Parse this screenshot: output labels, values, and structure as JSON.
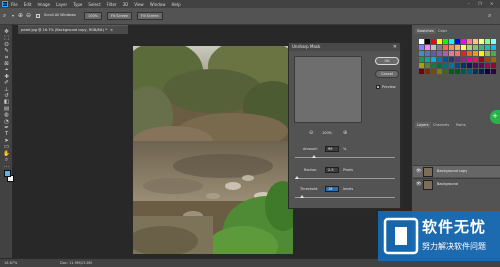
{
  "menubar": {
    "logo": "Ps",
    "items": [
      "File",
      "Edit",
      "Image",
      "Layer",
      "Type",
      "Select",
      "Filter",
      "3D",
      "View",
      "Window",
      "Help"
    ],
    "controls": {
      "minimize": "–",
      "maximize": "❐",
      "close": "✕"
    }
  },
  "optbar": {
    "scroll_all_label": "Scroll All Windows",
    "zoom_label": "100%",
    "fit_screen_label": "Fit Screen",
    "fill_screen_label": "Fill Screen"
  },
  "document": {
    "tab_title": "pexel.jpg @ 16.7% (Background copy, RGB/8#) *",
    "tab_close": "×"
  },
  "status": {
    "zoom": "16.67%",
    "doc_info": "Doc: 11.9M/23.8M"
  },
  "dialog": {
    "title": "Unsharp Mask",
    "close": "✕",
    "ok_label": "OK",
    "cancel_label": "Cancel",
    "preview_label": "Preview",
    "preview_checked": true,
    "zoom_out": "⊖",
    "zoom_in": "⊕",
    "zoom_pct": "100%",
    "amount": {
      "label": "Amount:",
      "value": "99",
      "unit": "%",
      "level": 0.19
    },
    "radius": {
      "label": "Radius:",
      "value": "2.5",
      "unit": "Pixels",
      "level": 0.02
    },
    "threshold": {
      "label": "Threshold:",
      "value": "18",
      "unit": "levels",
      "level": 0.07
    }
  },
  "panels": {
    "swatches_tabs": [
      "Swatches",
      "Color"
    ],
    "swatch_colors": [
      "#ffffff",
      "#000000",
      "#ff0000",
      "#ffff00",
      "#00ff00",
      "#00ffff",
      "#0000ff",
      "#ff00ff",
      "#ff8080",
      "#ffbf80",
      "#ffff80",
      "#80ff80",
      "#80ffff",
      "#8080ff",
      "#ff80ff",
      "#c0c0c0",
      "#808080",
      "#f26c4f",
      "#f68e55",
      "#fbaf5c",
      "#fff467",
      "#acd372",
      "#7cc576",
      "#3bb878",
      "#1abbb4",
      "#00bff3",
      "#438ccb",
      "#5574b9",
      "#605ca8",
      "#855fa8",
      "#a763a8",
      "#f06ea9",
      "#f26d7d",
      "#ed1c24",
      "#f26522",
      "#f7941d",
      "#fff200",
      "#8dc63f",
      "#39b54a",
      "#00a651",
      "#00a99d",
      "#00aeef",
      "#0072bc",
      "#0054a6",
      "#2e3192",
      "#662d91",
      "#92278f",
      "#ec008c",
      "#ed145b",
      "#9e0b0f",
      "#a0410d",
      "#a36209",
      "#aba000",
      "#598527",
      "#1a7b30",
      "#007236",
      "#00746b",
      "#0076a3",
      "#004b80",
      "#003471",
      "#1b1464",
      "#440e62",
      "#630460",
      "#9e005d",
      "#9e0039",
      "#790000",
      "#7b2e00",
      "#7d4900",
      "#827b00",
      "#406618",
      "#005e20",
      "#005826",
      "#005952",
      "#005b7f",
      "#003663",
      "#002157",
      "#0d004c",
      "#32004b"
    ],
    "layer_tabs": [
      "Layers",
      "Channels",
      "Paths"
    ],
    "layers": [
      {
        "name": "Background copy",
        "selected": true
      },
      {
        "name": "Background",
        "selected": false
      }
    ],
    "eye": "👁"
  },
  "watermark": {
    "title": "软件无忧",
    "subtitle": "努力解决软件问题"
  },
  "tools": [
    {
      "name": "move-tool-icon",
      "glyph": "✥"
    },
    {
      "name": "marquee-tool-icon",
      "glyph": "⬚"
    },
    {
      "name": "lasso-tool-icon",
      "glyph": "ʘ"
    },
    {
      "name": "quick-select-tool-icon",
      "glyph": "✎"
    },
    {
      "name": "crop-tool-icon",
      "glyph": "⌗"
    },
    {
      "name": "frame-tool-icon",
      "glyph": "⊠"
    },
    {
      "name": "eyedropper-tool-icon",
      "glyph": "⌖"
    },
    {
      "name": "healing-brush-tool-icon",
      "glyph": "✚"
    },
    {
      "name": "brush-tool-icon",
      "glyph": "✐"
    },
    {
      "name": "clone-stamp-tool-icon",
      "glyph": "⊥"
    },
    {
      "name": "history-brush-tool-icon",
      "glyph": "↺"
    },
    {
      "name": "eraser-tool-icon",
      "glyph": "◧"
    },
    {
      "name": "gradient-tool-icon",
      "glyph": "▤"
    },
    {
      "name": "blur-tool-icon",
      "glyph": "◍"
    },
    {
      "name": "dodge-tool-icon",
      "glyph": "◔"
    },
    {
      "name": "pen-tool-icon",
      "glyph": "✒"
    },
    {
      "name": "type-tool-icon",
      "glyph": "T"
    },
    {
      "name": "path-select-tool-icon",
      "glyph": "➤"
    },
    {
      "name": "rectangle-tool-icon",
      "glyph": "▭"
    },
    {
      "name": "hand-tool-icon",
      "glyph": "✋"
    },
    {
      "name": "zoom-tool-icon",
      "glyph": "⌕"
    },
    {
      "name": "more-tools-icon",
      "glyph": "…"
    }
  ],
  "colors": {
    "foreground": "#5bb4e5",
    "background": "#f4f4f4",
    "panel_accent": "#31a8ff"
  }
}
